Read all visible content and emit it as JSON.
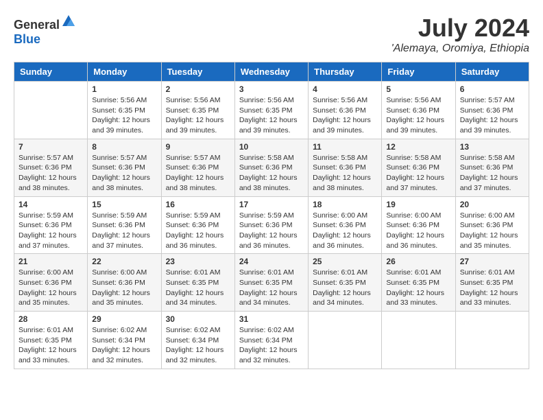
{
  "header": {
    "logo": {
      "general": "General",
      "blue": "Blue"
    },
    "month_year": "July 2024",
    "location": "'Alemaya, Oromiya, Ethiopia"
  },
  "calendar": {
    "days_of_week": [
      "Sunday",
      "Monday",
      "Tuesday",
      "Wednesday",
      "Thursday",
      "Friday",
      "Saturday"
    ],
    "weeks": [
      [
        {
          "day": "",
          "info": ""
        },
        {
          "day": "1",
          "info": "Sunrise: 5:56 AM\nSunset: 6:35 PM\nDaylight: 12 hours\nand 39 minutes."
        },
        {
          "day": "2",
          "info": "Sunrise: 5:56 AM\nSunset: 6:35 PM\nDaylight: 12 hours\nand 39 minutes."
        },
        {
          "day": "3",
          "info": "Sunrise: 5:56 AM\nSunset: 6:35 PM\nDaylight: 12 hours\nand 39 minutes."
        },
        {
          "day": "4",
          "info": "Sunrise: 5:56 AM\nSunset: 6:36 PM\nDaylight: 12 hours\nand 39 minutes."
        },
        {
          "day": "5",
          "info": "Sunrise: 5:56 AM\nSunset: 6:36 PM\nDaylight: 12 hours\nand 39 minutes."
        },
        {
          "day": "6",
          "info": "Sunrise: 5:57 AM\nSunset: 6:36 PM\nDaylight: 12 hours\nand 39 minutes."
        }
      ],
      [
        {
          "day": "7",
          "info": "Sunrise: 5:57 AM\nSunset: 6:36 PM\nDaylight: 12 hours\nand 38 minutes."
        },
        {
          "day": "8",
          "info": "Sunrise: 5:57 AM\nSunset: 6:36 PM\nDaylight: 12 hours\nand 38 minutes."
        },
        {
          "day": "9",
          "info": "Sunrise: 5:57 AM\nSunset: 6:36 PM\nDaylight: 12 hours\nand 38 minutes."
        },
        {
          "day": "10",
          "info": "Sunrise: 5:58 AM\nSunset: 6:36 PM\nDaylight: 12 hours\nand 38 minutes."
        },
        {
          "day": "11",
          "info": "Sunrise: 5:58 AM\nSunset: 6:36 PM\nDaylight: 12 hours\nand 38 minutes."
        },
        {
          "day": "12",
          "info": "Sunrise: 5:58 AM\nSunset: 6:36 PM\nDaylight: 12 hours\nand 37 minutes."
        },
        {
          "day": "13",
          "info": "Sunrise: 5:58 AM\nSunset: 6:36 PM\nDaylight: 12 hours\nand 37 minutes."
        }
      ],
      [
        {
          "day": "14",
          "info": "Sunrise: 5:59 AM\nSunset: 6:36 PM\nDaylight: 12 hours\nand 37 minutes."
        },
        {
          "day": "15",
          "info": "Sunrise: 5:59 AM\nSunset: 6:36 PM\nDaylight: 12 hours\nand 37 minutes."
        },
        {
          "day": "16",
          "info": "Sunrise: 5:59 AM\nSunset: 6:36 PM\nDaylight: 12 hours\nand 36 minutes."
        },
        {
          "day": "17",
          "info": "Sunrise: 5:59 AM\nSunset: 6:36 PM\nDaylight: 12 hours\nand 36 minutes."
        },
        {
          "day": "18",
          "info": "Sunrise: 6:00 AM\nSunset: 6:36 PM\nDaylight: 12 hours\nand 36 minutes."
        },
        {
          "day": "19",
          "info": "Sunrise: 6:00 AM\nSunset: 6:36 PM\nDaylight: 12 hours\nand 36 minutes."
        },
        {
          "day": "20",
          "info": "Sunrise: 6:00 AM\nSunset: 6:36 PM\nDaylight: 12 hours\nand 35 minutes."
        }
      ],
      [
        {
          "day": "21",
          "info": "Sunrise: 6:00 AM\nSunset: 6:36 PM\nDaylight: 12 hours\nand 35 minutes."
        },
        {
          "day": "22",
          "info": "Sunrise: 6:00 AM\nSunset: 6:36 PM\nDaylight: 12 hours\nand 35 minutes."
        },
        {
          "day": "23",
          "info": "Sunrise: 6:01 AM\nSunset: 6:35 PM\nDaylight: 12 hours\nand 34 minutes."
        },
        {
          "day": "24",
          "info": "Sunrise: 6:01 AM\nSunset: 6:35 PM\nDaylight: 12 hours\nand 34 minutes."
        },
        {
          "day": "25",
          "info": "Sunrise: 6:01 AM\nSunset: 6:35 PM\nDaylight: 12 hours\nand 34 minutes."
        },
        {
          "day": "26",
          "info": "Sunrise: 6:01 AM\nSunset: 6:35 PM\nDaylight: 12 hours\nand 33 minutes."
        },
        {
          "day": "27",
          "info": "Sunrise: 6:01 AM\nSunset: 6:35 PM\nDaylight: 12 hours\nand 33 minutes."
        }
      ],
      [
        {
          "day": "28",
          "info": "Sunrise: 6:01 AM\nSunset: 6:35 PM\nDaylight: 12 hours\nand 33 minutes."
        },
        {
          "day": "29",
          "info": "Sunrise: 6:02 AM\nSunset: 6:34 PM\nDaylight: 12 hours\nand 32 minutes."
        },
        {
          "day": "30",
          "info": "Sunrise: 6:02 AM\nSunset: 6:34 PM\nDaylight: 12 hours\nand 32 minutes."
        },
        {
          "day": "31",
          "info": "Sunrise: 6:02 AM\nSunset: 6:34 PM\nDaylight: 12 hours\nand 32 minutes."
        },
        {
          "day": "",
          "info": ""
        },
        {
          "day": "",
          "info": ""
        },
        {
          "day": "",
          "info": ""
        }
      ]
    ]
  }
}
